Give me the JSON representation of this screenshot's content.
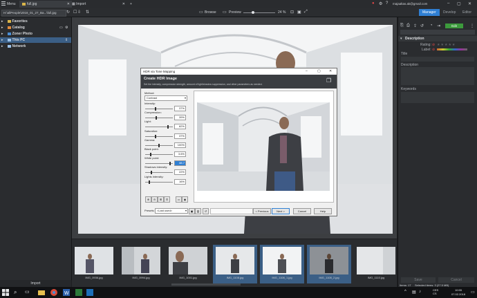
{
  "topbar": {
    "menu_label": "Menu",
    "tab1_label": "full.jpg",
    "tab2_label": "Import",
    "add_tab": "+",
    "email": "majaaltas.ak@gmail.com",
    "window_controls": [
      "–",
      "▢",
      "✕"
    ]
  },
  "toolbar": {
    "path": "H:\\allPeople\\2018_01_27_Ba...\\full.jpg",
    "browse_label": "Browse",
    "preview_label": "Preview",
    "zoom": "24 %",
    "modes": [
      "Manager",
      "Develop",
      "Editor"
    ]
  },
  "nav": {
    "items": [
      "Favorites",
      "Catalog",
      "Zoner Photo",
      "This PC",
      "Network"
    ],
    "import_label": "Import"
  },
  "rightpanel": {
    "edit_label": "Edit",
    "description_header": "Description",
    "rating_label": "Rating:",
    "label_label": "Label:",
    "title_label": "Title",
    "description_label": "Description",
    "keywords_label": "Keywords",
    "save_label": "Save",
    "cancel_label": "Cancel"
  },
  "dialog": {
    "window_title": "HDR via Tone Mapping",
    "header_title": "Create HDR Image",
    "header_subtitle": "Set the intensity, compression strength, amount of light/shadow suppression, and other parameters as needed.",
    "method_label": "Method:",
    "method_value": "Contrast",
    "sliders": [
      {
        "label": "Intensity:",
        "value": "37%",
        "level": 0.37
      },
      {
        "label": "Compression:",
        "value": "39%",
        "level": 0.39
      },
      {
        "label": "Light:",
        "value": "82%",
        "level": 0.82
      },
      {
        "label": "Saturation:",
        "value": "37%",
        "level": 0.37
      },
      {
        "label": "Gamma:",
        "value": "100%",
        "level": 0.5
      },
      {
        "label": "Black point:",
        "value": "3.6%",
        "level": 0.2
      },
      {
        "label": "White point:",
        "value": "88.7",
        "level": 0.9
      },
      {
        "label": "Shadows intensity:",
        "value": "22%",
        "level": 0.22
      },
      {
        "label": "Lights intensity:",
        "value": "16%",
        "level": 0.16
      }
    ],
    "presets_label": "Presets:",
    "presets_value": "<Last used>",
    "buttons": [
      "< Previous",
      "Next >",
      "Cancel",
      "Help"
    ]
  },
  "filmstrip": {
    "items": [
      {
        "caption": "IMG_0936.jpg",
        "selected": false
      },
      {
        "caption": "IMG_0994.jpg",
        "selected": false
      },
      {
        "caption": "IMG_1001.jpg",
        "selected": false
      },
      {
        "caption": "IMG_1108.jpg",
        "selected": true
      },
      {
        "caption": "IMG_1108_1.jpg",
        "selected": true
      },
      {
        "caption": "IMG_1108_2.jpg",
        "selected": true
      },
      {
        "caption": "IMG_1110.jpg",
        "selected": false
      }
    ]
  },
  "statusbar": {
    "items_label": "Items: 17",
    "selected_label": "Selected items: 3 (27.5 MB)"
  },
  "taskbar": {
    "lang": "CES\nCS",
    "time": "10:55",
    "date": "07.02.2018"
  },
  "colors": {
    "accent": "#2f7fd3",
    "selection": "#3b5f86",
    "folder": "#d9b54a",
    "panel": "#2a2c2f"
  }
}
